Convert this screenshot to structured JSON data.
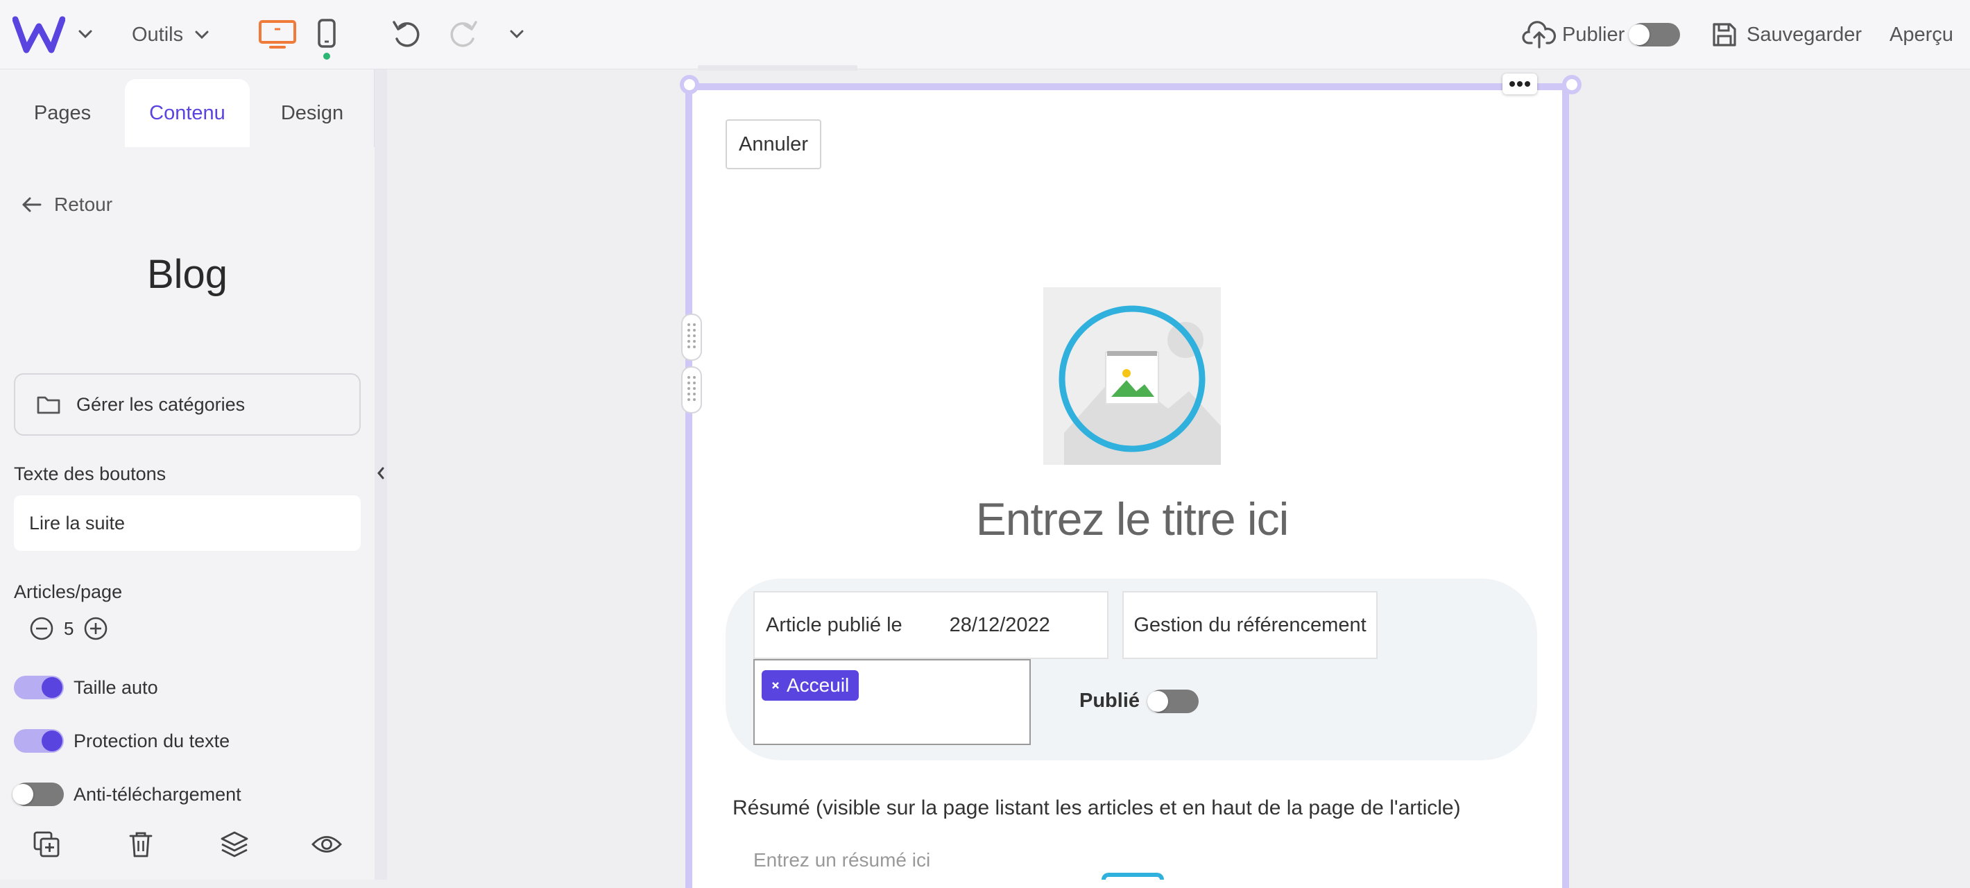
{
  "topbar": {
    "tools_label": "Outils",
    "publish_label": "Publier",
    "save_label": "Sauvegarder",
    "preview_label": "Aperçu"
  },
  "sidebar": {
    "tabs": [
      {
        "label": "Pages"
      },
      {
        "label": "Contenu"
      },
      {
        "label": "Design"
      }
    ],
    "back_label": "Retour",
    "title": "Blog",
    "manage_categories_label": "Gérer les catégories",
    "button_text_label": "Texte des boutons",
    "button_text_value": "Lire la suite",
    "articles_per_page_label": "Articles/page",
    "articles_per_page_value": "5",
    "toggles": [
      {
        "label": "Taille auto",
        "on": true
      },
      {
        "label": "Protection du texte",
        "on": true
      },
      {
        "label": "Anti-téléchargement",
        "on": false
      }
    ]
  },
  "editor": {
    "cancel_label": "Annuler",
    "title_placeholder": "Entrez le titre ici",
    "published_on_label": "Article publié le",
    "published_on_date": "28/12/2022",
    "seo_label": "Gestion du référencement",
    "category_tag": "Acceuil",
    "published_label": "Publié",
    "published_on": false,
    "summary_label": "Résumé (visible sur la page listant les articles et en haut de la page de l'article)",
    "summary_placeholder": "Entrez un résumé ici"
  },
  "colors": {
    "accent": "#5a44e0",
    "device_active": "#f07a3a",
    "frame_border": "#cfc8f6",
    "status_dot": "#2bb673"
  }
}
